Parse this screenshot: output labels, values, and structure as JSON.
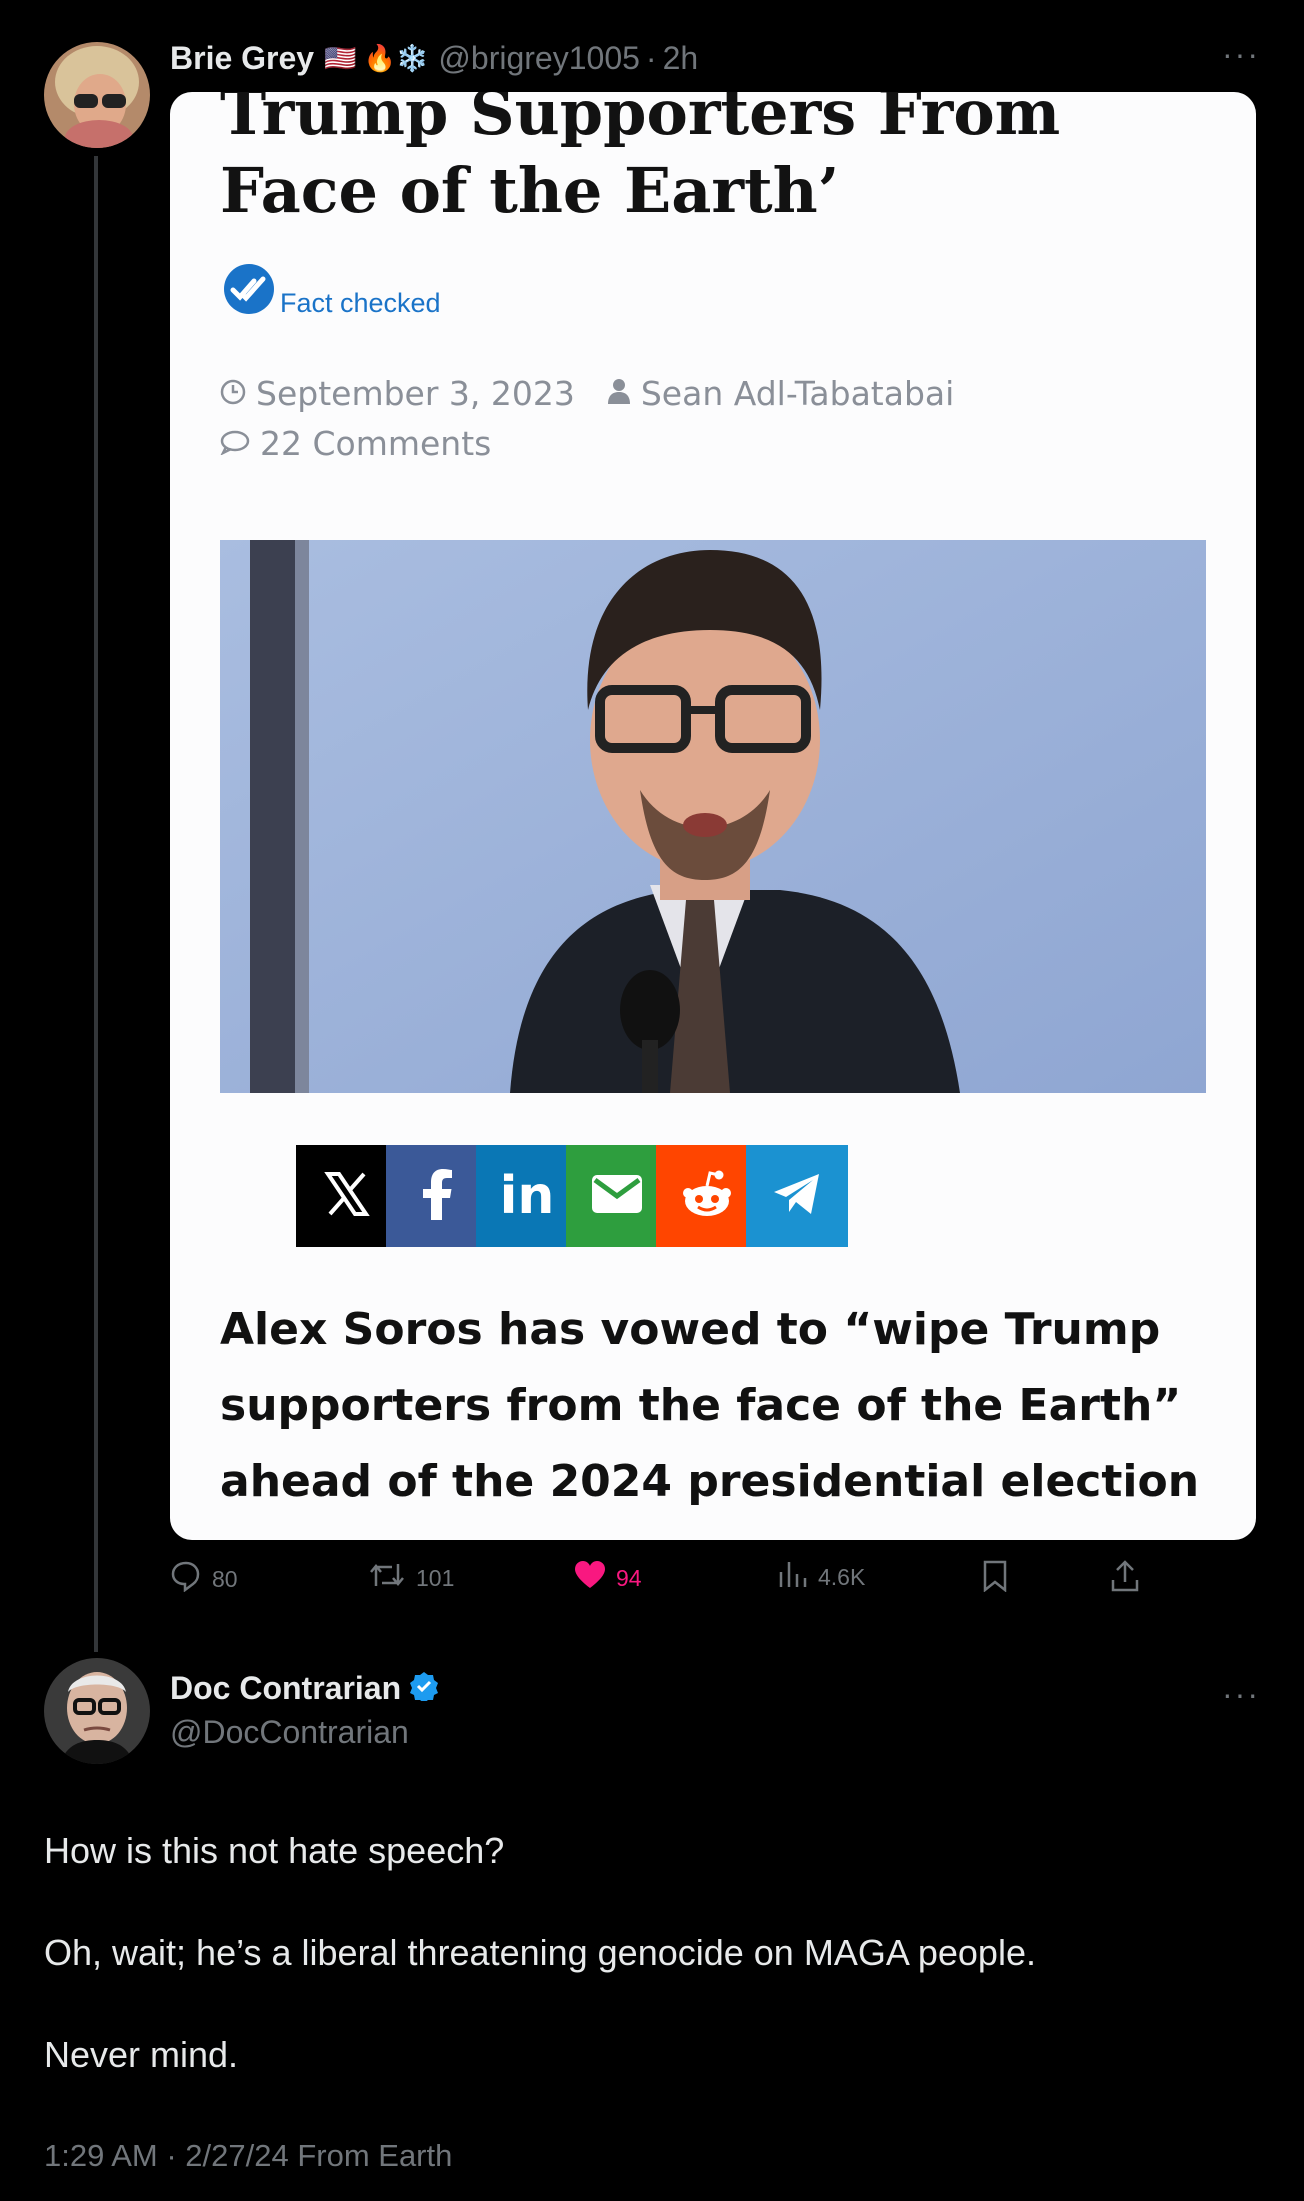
{
  "tweet": {
    "author_name": "Brie Grey",
    "author_emojis": "🇺🇸 🔥❄️",
    "author_handle": "@brigrey1005",
    "separator": "·",
    "time": "2h",
    "more": "···",
    "card": {
      "headline": "Trump Supporters From Face of the Earth’",
      "fact_checked": "Fact checked",
      "date": "September 3, 2023",
      "author": "Sean Adl-Tabatabai",
      "comments": "22 Comments",
      "share_buttons": [
        {
          "name": "x",
          "color": "#000000"
        },
        {
          "name": "facebook",
          "color": "#3b5998"
        },
        {
          "name": "linkedin",
          "color": "#0a77b5"
        },
        {
          "name": "email",
          "color": "#2e9e3e"
        },
        {
          "name": "reddit",
          "color": "#ff4500"
        },
        {
          "name": "telegram",
          "color": "#1b92d1"
        }
      ],
      "subheadline": "Alex Soros has vowed to “wipe Trump supporters from the face of the Earth” ahead of the 2024 presidential election"
    },
    "actions": {
      "replies": "80",
      "reposts": "101",
      "likes": "94",
      "views": "4.6K"
    }
  },
  "reply": {
    "author_name": "Doc Contrarian",
    "author_handle": "@DocContrarian",
    "more": "···",
    "line1": "How is this not hate speech?",
    "line2": "Oh, wait; he’s a liberal threatening genocide on MAGA people.",
    "line3": "Never mind.",
    "timestamp": "1:29 AM · 2/27/24 From Earth"
  },
  "colors": {
    "background": "#000000",
    "like": "#f91880",
    "verified": "#1d9bf0",
    "link": "#1a73c8"
  }
}
